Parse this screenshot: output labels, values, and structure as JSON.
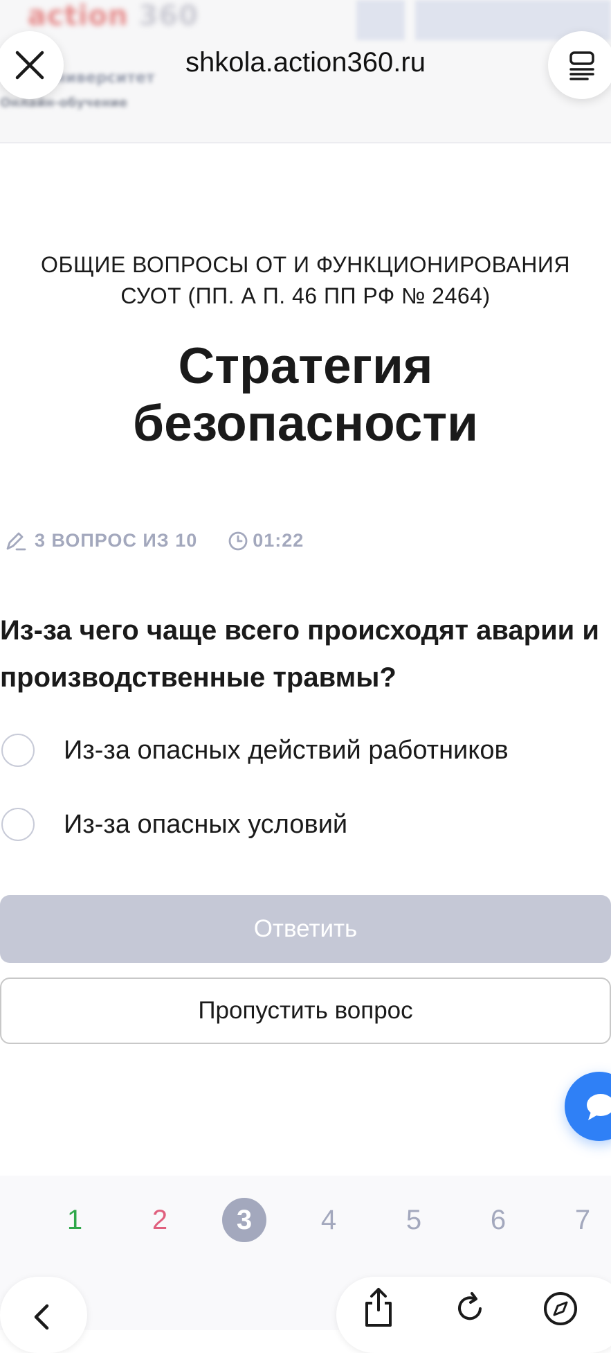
{
  "browser": {
    "url": "shkola.action360.ru"
  },
  "site": {
    "logo_text": "action",
    "logo_num": "360",
    "subtitle_1": "к Университет",
    "subtitle_2": "Онлайн-обучение"
  },
  "quiz": {
    "category": "ОБЩИЕ ВОПРОСЫ ОТ И ФУНКЦИОНИРОВАНИЯ СУОТ (ПП. А П. 46 ПП РФ № 2464)",
    "title": "Стратегия безопасности",
    "progress_text": "3 ВОПРОС ИЗ 10",
    "current_question": 3,
    "total_questions": 10,
    "timer": "01:22",
    "question": "Из-за чего чаще всего происходят аварии и производственные травмы?",
    "options": [
      {
        "label": "Из-за опасных действий работников",
        "selected": false
      },
      {
        "label": "Из-за опасных условий",
        "selected": false
      }
    ],
    "answer_label": "Ответить",
    "skip_label": "Пропустить вопрос"
  },
  "pager": {
    "pages": [
      {
        "label": "1",
        "state": "correct"
      },
      {
        "label": "2",
        "state": "wrong"
      },
      {
        "label": "3",
        "state": "current"
      },
      {
        "label": "4",
        "state": "pending"
      },
      {
        "label": "5",
        "state": "pending"
      },
      {
        "label": "6",
        "state": "pending"
      },
      {
        "label": "7",
        "state": "pending"
      }
    ]
  },
  "colors": {
    "accent_blue": "#2f80f6",
    "muted": "#a3a8bd",
    "correct": "#2fa84a",
    "wrong": "#e0607e",
    "disabled_button": "#c5c8d6"
  },
  "icons": [
    "close-icon",
    "reader-icon",
    "pencil-icon",
    "clock-icon",
    "chat-icon",
    "back-icon",
    "share-icon",
    "reload-icon",
    "compass-icon"
  ]
}
